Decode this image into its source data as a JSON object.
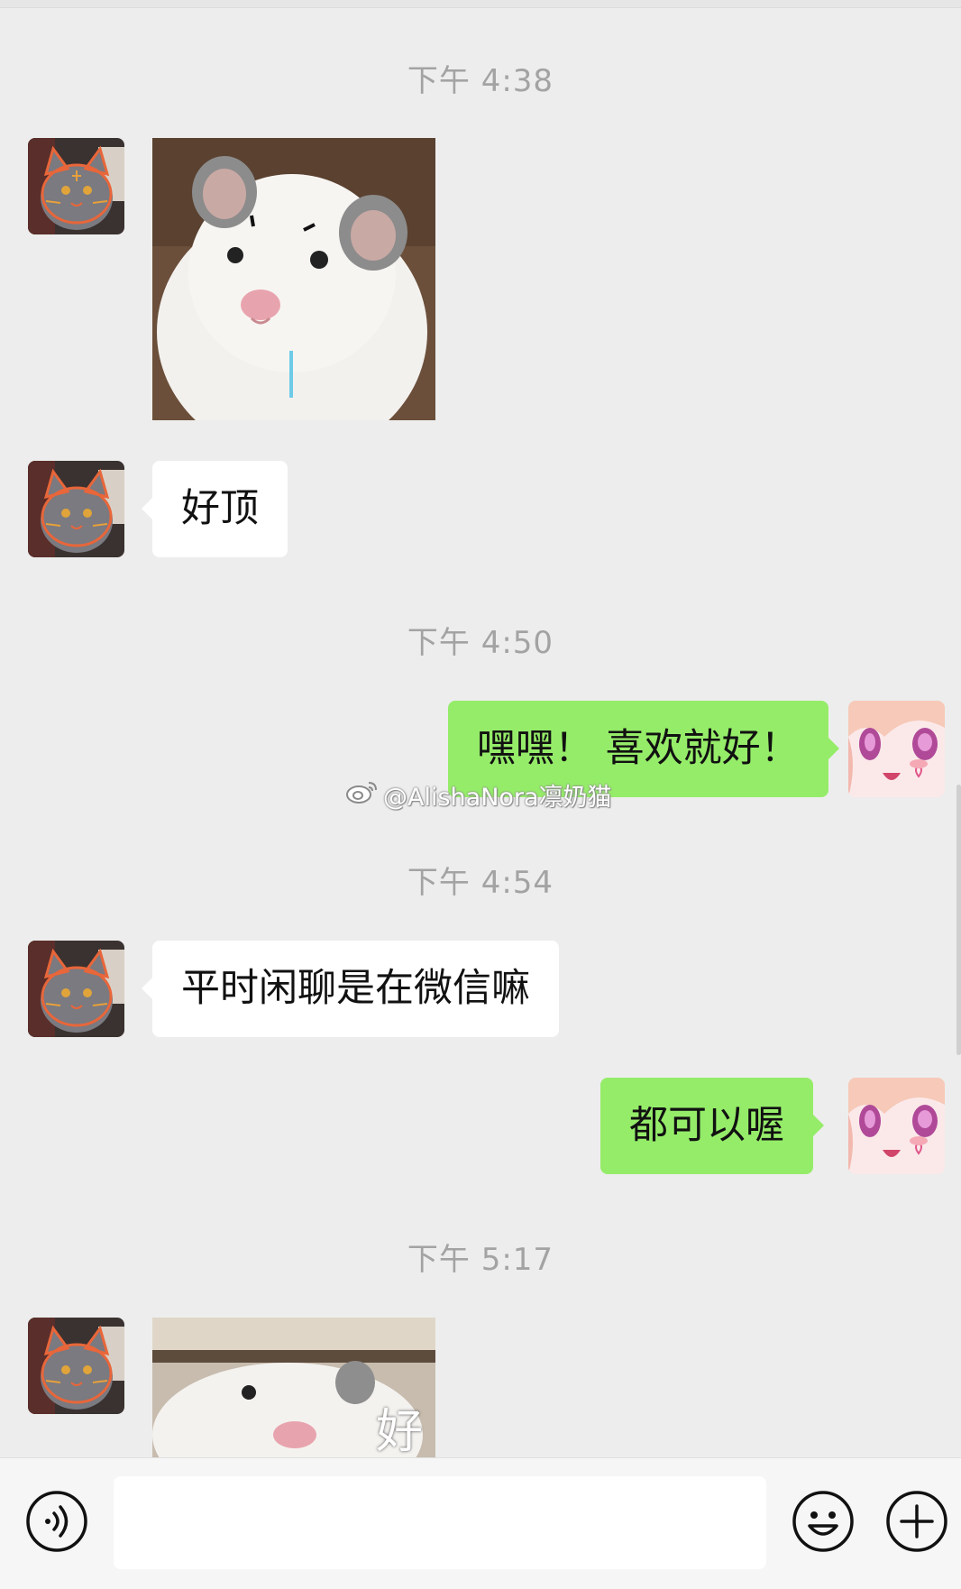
{
  "messages": {
    "ts1": "下午 4:38",
    "bubble_1": "好顶",
    "ts2": "下午 4:50",
    "bubble_2": "嘿嘿！ 喜欢就好！",
    "ts3": "下午 4:54",
    "bubble_3": "平时闲聊是在微信嘛",
    "bubble_4": "都可以喔",
    "ts4": "下午 5:17",
    "sticker_2_text": "好"
  },
  "watermark": "@AlishaNora凛奶猫",
  "input_bar": {
    "voice_icon": "voice-icon",
    "emoji_icon": "emoji-icon",
    "plus_icon": "plus-icon"
  },
  "colors": {
    "background": "#ededed",
    "incoming_bubble": "#ffffff",
    "outgoing_bubble": "#95ec69",
    "timestamp": "#a3a3a3"
  }
}
